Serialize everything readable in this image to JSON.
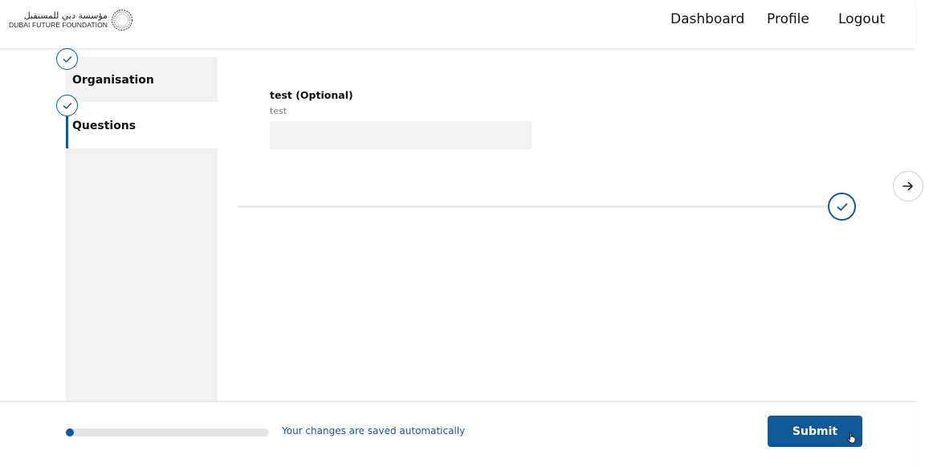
{
  "header": {
    "logo_arabic": "مؤسسة دبي للمستقبل",
    "logo_english": "DUBAI FUTURE FOUNDATION",
    "nav": {
      "dashboard": "Dashboard",
      "profile": "Profile",
      "logout": "Logout"
    }
  },
  "sidebar": {
    "items": [
      {
        "label": "Organisation",
        "status": "completed",
        "active": false
      },
      {
        "label": "Questions",
        "status": "completed",
        "active": true
      }
    ]
  },
  "question": {
    "label": "test (Optional)",
    "hint": "test",
    "value": "",
    "placeholder": ""
  },
  "footer": {
    "progress_percent": 2,
    "autosave_text": "Your changes are saved automatically",
    "submit_label": "Submit"
  },
  "colors": {
    "accent": "#0f5a96",
    "panel_bg": "#f2f2f2"
  },
  "icons": {
    "step_complete": "check-circle-icon",
    "section_complete": "check-circle-icon",
    "next": "arrow-right-icon"
  }
}
